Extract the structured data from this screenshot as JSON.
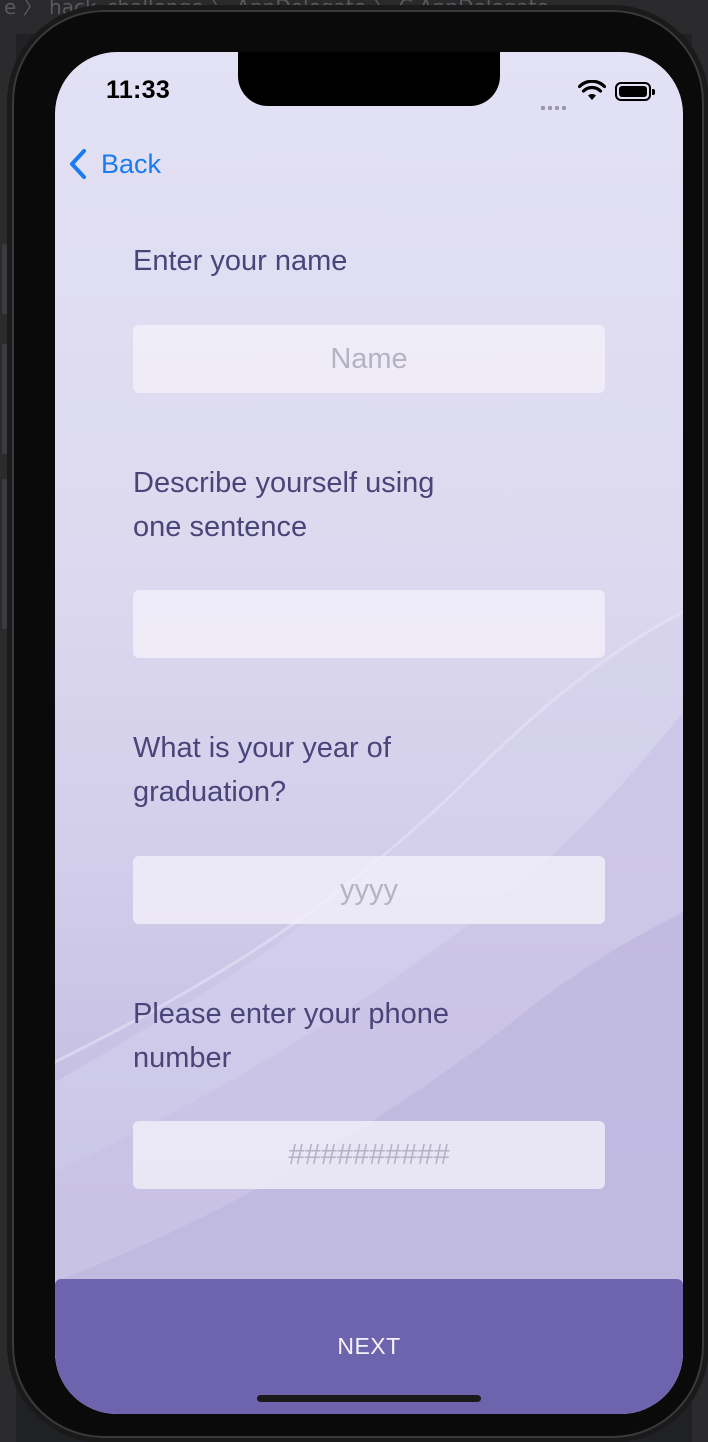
{
  "backdrop": {
    "breadcrumb": "e 〉 hack_challenge 〉 AppDelegate 〉 C AppDelegate"
  },
  "status_bar": {
    "time": "11:33",
    "icons": [
      "cellular-signal-icon",
      "wifi-icon",
      "battery-icon"
    ]
  },
  "nav": {
    "back_label": "Back"
  },
  "form": {
    "name_question": "Enter your name",
    "name_placeholder": "Name",
    "name_value": "",
    "describe_question": "Describe yourself using\none sentence",
    "describe_placeholder": "",
    "describe_value": "",
    "graduation_question": "What is your year of\n graduation?",
    "graduation_placeholder": "yyyy",
    "graduation_value": "",
    "phone_question": "Please enter your phone\nnumber",
    "phone_placeholder": "##########",
    "phone_value": ""
  },
  "footer": {
    "next_label": "NEXT"
  },
  "colors": {
    "accent": "#6d64ad",
    "link": "#1a7cf0",
    "question_text": "#4a4578",
    "background_top": "#e3e1f4",
    "background_bottom": "#b9b1dc"
  }
}
